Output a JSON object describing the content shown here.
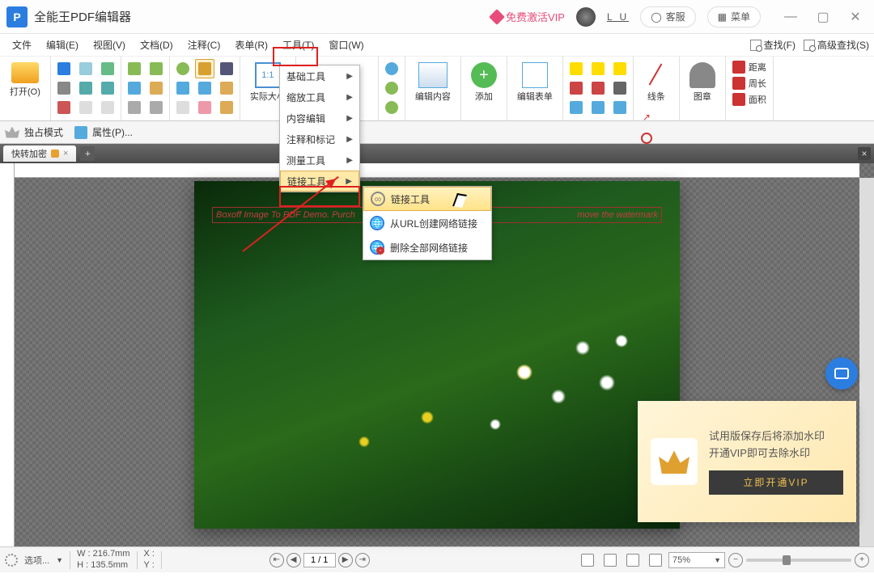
{
  "app": {
    "title": "全能王PDF编辑器",
    "logo_letter": "P"
  },
  "titlebar": {
    "vip": "免费激活VIP",
    "user": "L U",
    "support": "客服",
    "menu": "菜单"
  },
  "menubar": {
    "items": [
      {
        "label": "文件"
      },
      {
        "label": "编辑(E)"
      },
      {
        "label": "视图(V)"
      },
      {
        "label": "文档(D)"
      },
      {
        "label": "注释(C)"
      },
      {
        "label": "表单(R)"
      },
      {
        "label": "工具(T)"
      },
      {
        "label": "窗口(W)"
      }
    ],
    "find": "查找(F)",
    "adv_find": "高级查找(S)"
  },
  "toolbar": {
    "open": "打开(O)",
    "actual_size": "实际大小",
    "edit_content": "编辑内容",
    "add": "添加",
    "edit_form": "编辑表单",
    "lines": "线条",
    "image": "图章",
    "distance": "距离",
    "perimeter": "周长",
    "area": "面积"
  },
  "secondary": {
    "exclusive": "独占模式",
    "props": "属性(P)..."
  },
  "tabs": {
    "tab1": "快转加密"
  },
  "dropdown": {
    "items": [
      "基础工具",
      "缩放工具",
      "内容编辑",
      "注释和标记",
      "测量工具",
      "链接工具"
    ]
  },
  "submenu": {
    "items": [
      "链接工具",
      "从URL创建网络链接",
      "删除全部网络链接"
    ]
  },
  "watermark": {
    "left": "Boxoff Image To PDF Demo. Purch",
    "right": "move the watermark"
  },
  "vip_popup": {
    "line1": "试用版保存后将添加水印",
    "line2": "开通VIP即可去除水印",
    "button": "立即开通VIP"
  },
  "statusbar": {
    "options": "选项...",
    "w_label": "W :",
    "w_val": "216.7mm",
    "h_label": "H :",
    "h_val": "135.5mm",
    "x_label": "X :",
    "y_label": "Y :",
    "page": "1 / 1",
    "zoom": "75%"
  }
}
